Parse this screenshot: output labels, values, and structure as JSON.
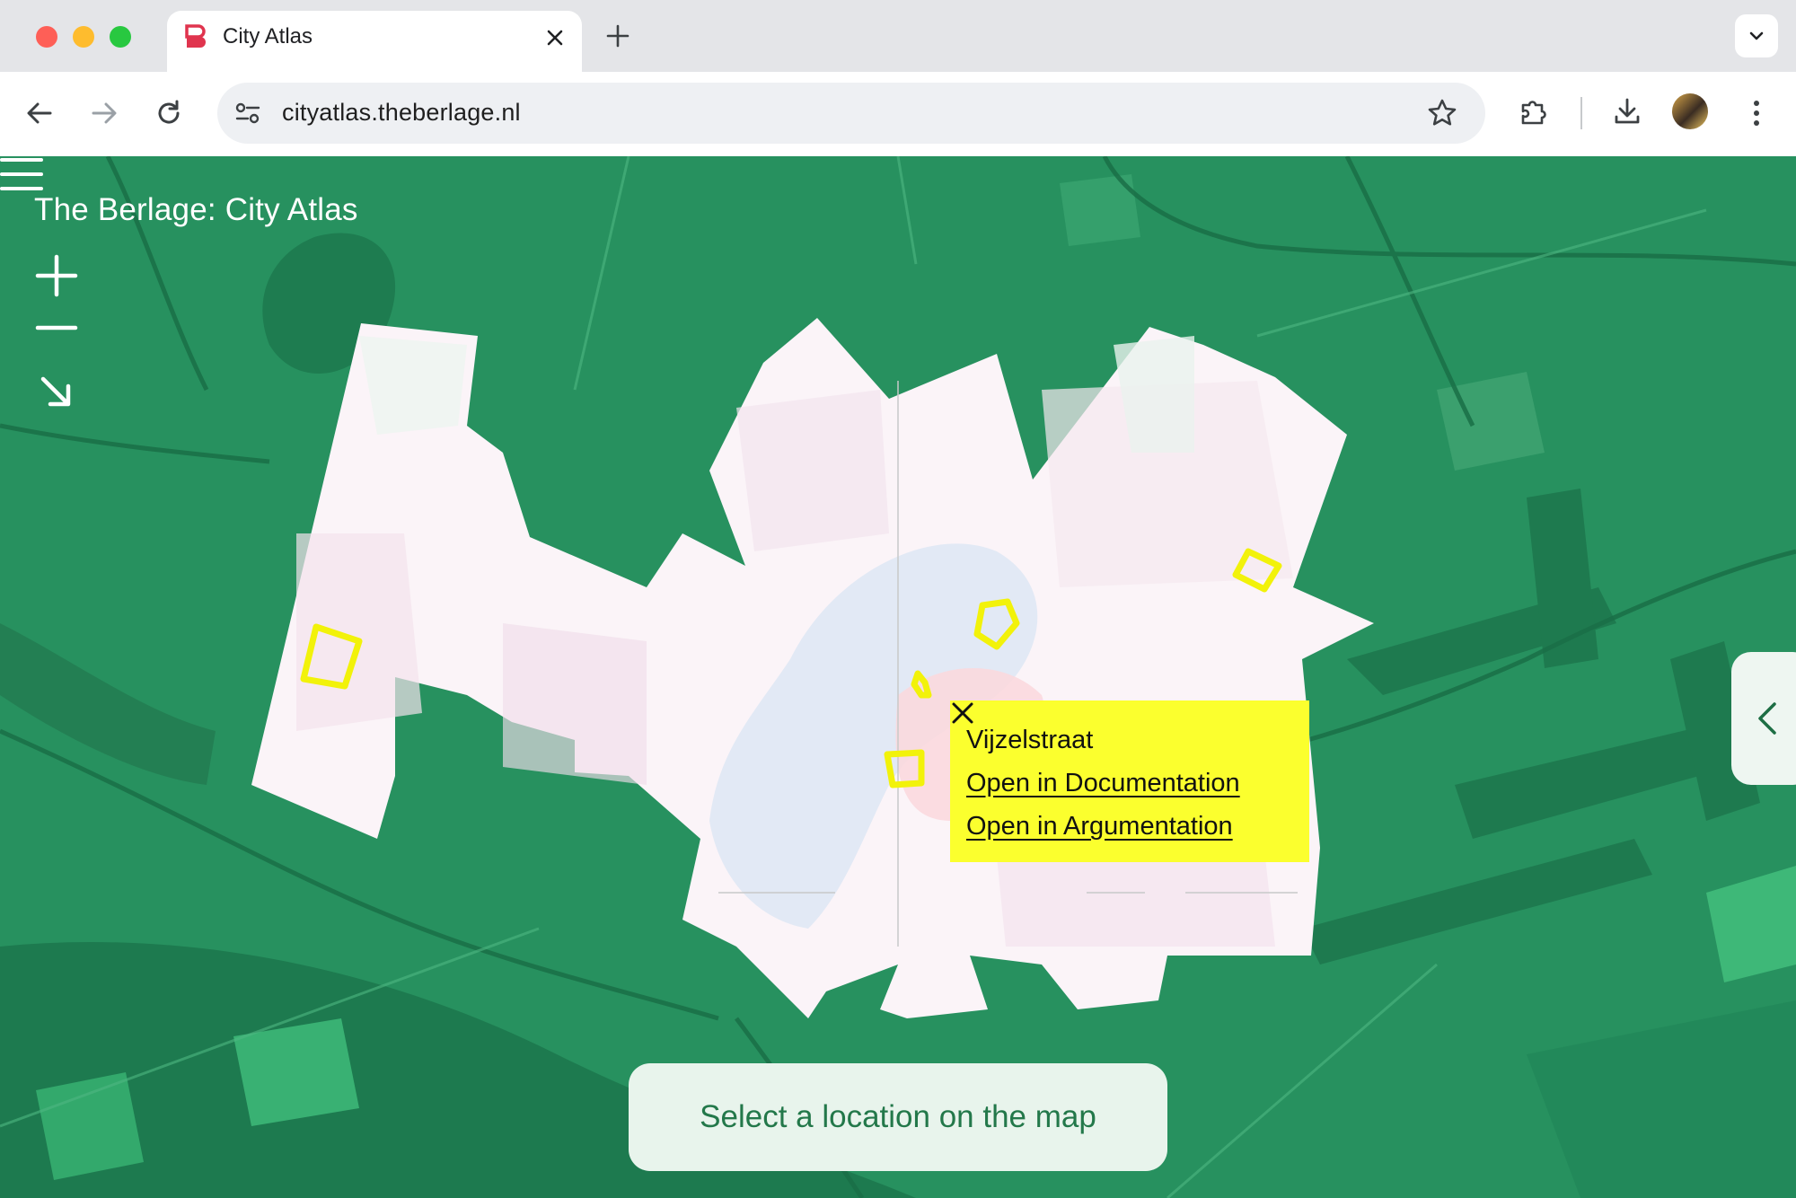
{
  "browser": {
    "tab": {
      "title": "City Atlas",
      "favicon": "berlage-logo-icon"
    },
    "address_bar": {
      "url": "cityatlas.theberlage.nl"
    },
    "window_controls": [
      "close-dot",
      "minimize-dot",
      "zoom-dot"
    ],
    "toolbar_icons": [
      "back-icon",
      "forward-icon",
      "reload-icon",
      "site-settings-icon",
      "bookmark-star-icon",
      "extensions-icon",
      "download-icon",
      "profile-avatar",
      "more-menu-icon"
    ]
  },
  "app": {
    "site_title": "The Berlage: City Atlas",
    "map_controls": [
      "zoom-in-icon",
      "zoom-out-icon",
      "reset-view-arrow-icon"
    ],
    "popup": {
      "title": "Vijzelstraat",
      "link_documentation": "Open in Documentation",
      "link_argumentation": "Open in Argumentation"
    },
    "bottom_prompt": "Select a location on the map"
  },
  "colors": {
    "map_green": "#27915f",
    "map_dark_green": "#1c7a4e",
    "highlight_yellow": "#fbff2e",
    "marker_yellow": "#f2f20a",
    "city_area": "#fbf4f8",
    "pill_text": "#23784a"
  }
}
